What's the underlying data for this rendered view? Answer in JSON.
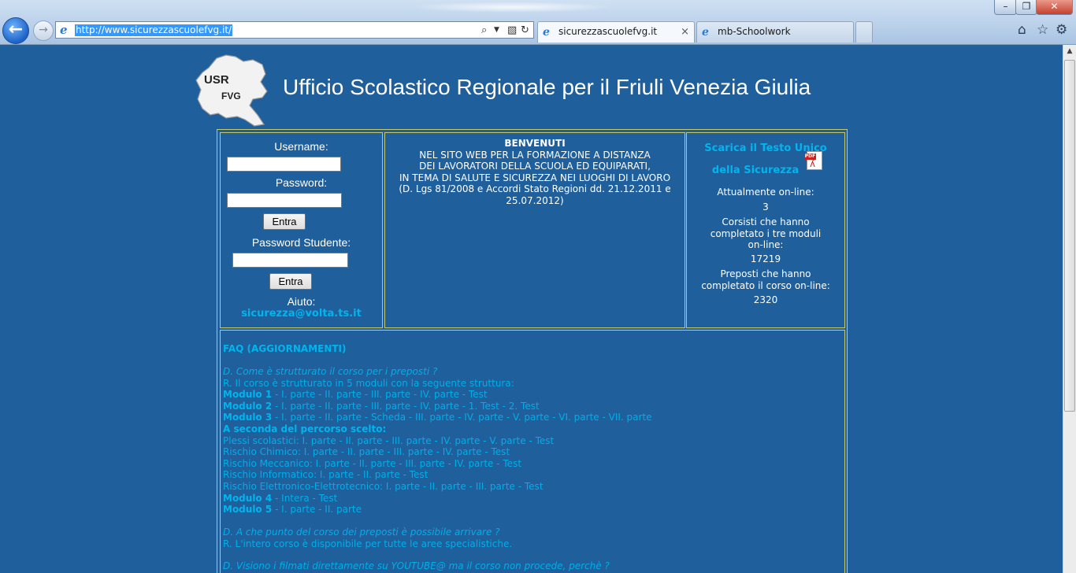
{
  "browser": {
    "url": "http://www.sicurezzascuolefvg.it/",
    "tabs": [
      {
        "label": "sicurezzascuolefvg.it",
        "close": "×"
      },
      {
        "label": "mb-Schoolwork"
      }
    ],
    "window_buttons": {
      "minimize": "–",
      "maximize": "❐",
      "close": "✕"
    },
    "icons": {
      "back": "arrow-left",
      "forward": "arrow-right",
      "home": "home",
      "favorites": "star",
      "tools": "gear"
    }
  },
  "header": {
    "logo_text_top": "USR",
    "logo_text_bottom": "FVG",
    "title": "Ufficio Scolastico Regionale per il Friuli Venezia Giulia"
  },
  "login": {
    "username_label": "Username:",
    "username_value": "",
    "password_label": "Password:",
    "password_value": "",
    "enter_label": "Entra",
    "student_password_label": "Password Studente:",
    "student_password_value": "",
    "enter_student_label": "Entra",
    "help_label": "Aiuto:",
    "help_email": "sicurezza@volta.ts.it"
  },
  "welcome": {
    "lines": [
      "BENVENUTI",
      "NEL SITO WEB PER LA FORMAZIONE A DISTANZA",
      "DEI LAVORATORI DELLA SCUOLA ED EQUIPARATI,",
      "IN TEMA DI SALUTE E SICUREZZA NEI LUOGHI DI LAVORO",
      "(D. Lgs 81/2008 e Accordi Stato Regioni dd. 21.12.2011 e",
      "25.07.2012)"
    ]
  },
  "stats": {
    "download_line1": "Scarica il Testo Unico",
    "download_line2": "della Sicurezza",
    "pdf_badge": "PDF",
    "online_label": "Attualmente on-line:",
    "online_count": "3",
    "completed_modules_label_1": "Corsisti che hanno",
    "completed_modules_label_2": "completato i tre moduli",
    "completed_modules_label_3": "on-line:",
    "completed_modules_count": "17219",
    "supervisors_label_1": "Preposti che hanno",
    "supervisors_label_2": "completato il corso on-line:",
    "supervisors_count": "2320"
  },
  "faq": {
    "heading": "FAQ (AGGIORNAMENTI)",
    "q1": "D. Come è strutturato il corso per i preposti ?",
    "a1": "R. Il corso è strutturato in 5 moduli con la seguente struttura:",
    "m1_label": "Modulo 1",
    "m1_text": " - I. parte - II. parte - III. parte - IV. parte - Test",
    "m2_label": "Modulo 2",
    "m2_text": " - I. parte - II. parte - III. parte - IV. parte - 1. Test - 2. Test",
    "m3_label": "Modulo 3",
    "m3_text": " - I. parte - II. parte - Scheda - III. parte - IV. parte - V. parte - VI. parte - VII. parte",
    "path_heading": "A seconda del percorso scelto:",
    "path_1": "Plessi scolastici: I. parte - II. parte - III. parte - IV. parte - V. parte - Test",
    "path_2": "Rischio Chimico: I. parte - II. parte - III. parte - IV. parte - Test",
    "path_3": "Rischio Meccanico: I. parte - II. parte - III. parte - IV. parte - Test",
    "path_4": "Rischio Informatico: I. parte - II. parte - Test",
    "path_5": "Rischio Elettronico-Elettrotecnico: I. parte - II. parte - III. parte - Test",
    "m4_label": "Modulo 4",
    "m4_text": " - Intera - Test",
    "m5_label": "Modulo 5",
    "m5_text": " - I. parte - II. parte",
    "q2": "D. A che punto del corso dei preposti è possibile arrivare ?",
    "a2": "R. L'intero corso è disponibile per tutte le aree specialistiche.",
    "q3": "D. Visiono i filmati direttamente su YOUTUBE@ ma il corso non procede, perchè ?"
  }
}
